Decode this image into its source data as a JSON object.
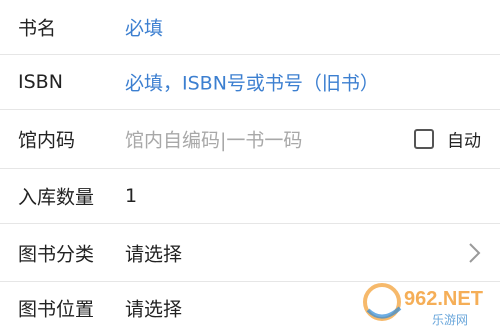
{
  "form": {
    "title": {
      "label": "书名",
      "placeholder": "必填"
    },
    "isbn": {
      "label": "ISBN",
      "placeholder": "必填，ISBN号或书号（旧书）"
    },
    "code": {
      "label": "馆内码",
      "placeholder": "馆内自编码|一书一码",
      "auto_label": "自动",
      "auto_checked": false
    },
    "quantity": {
      "label": "入库数量",
      "value": "1"
    },
    "category": {
      "label": "图书分类",
      "value": "请选择"
    },
    "location": {
      "label": "图书位置",
      "value": "请选择"
    }
  },
  "watermark": {
    "brand": "962.NET",
    "sub": "乐游网"
  },
  "colors": {
    "hint_blue": "#3c7fd0",
    "hint_gray": "#a8a8a8",
    "text": "#222222",
    "divider": "#e6e6e6"
  },
  "icons": {
    "category_arrow": "chevron-right-icon",
    "auto_checkbox": "checkbox-icon"
  }
}
